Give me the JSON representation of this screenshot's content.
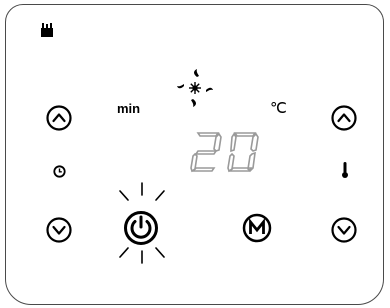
{
  "display": {
    "temperature_value": "20",
    "temperature_unit": "℃",
    "timer_unit": "min"
  },
  "icons": {
    "mode": "heater-mode-icon",
    "fan": "fan-icon",
    "timer": "clock-icon",
    "temperature": "thermometer-icon",
    "power_glow": "glow-rays"
  },
  "buttons": {
    "timer_up": "up-arrow",
    "timer_down": "down-arrow",
    "temp_up": "up-arrow",
    "temp_down": "down-arrow",
    "power": "power-symbol",
    "mode": "M"
  },
  "colors": {
    "outline": "#4a4a4a",
    "ink": "#000000",
    "display_segments": "#9a9a9a",
    "background": "#ffffff"
  }
}
